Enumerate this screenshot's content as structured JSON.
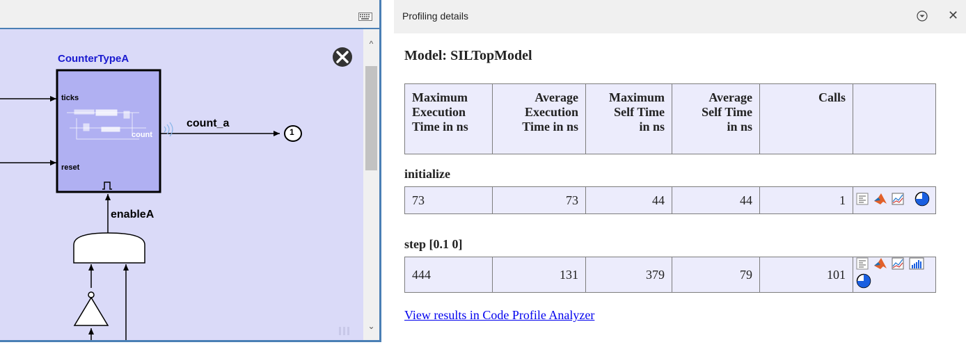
{
  "canvas": {
    "block_title": "CounterTypeA",
    "ports_in": [
      "ticks",
      "reset"
    ],
    "port_out": "count",
    "signal_out": "count_a",
    "outport_number": "1",
    "enable_label": "enableA"
  },
  "panel": {
    "title": "Profiling details",
    "model_title": "Model: SILTopModel",
    "headers": [
      "Maximum\nExecution\nTime in ns",
      "Average\nExecution\nTime in ns",
      "Maximum\nSelf Time\nin ns",
      "Average\nSelf Time\nin ns",
      "Calls"
    ],
    "sections": [
      {
        "name": "initialize",
        "values": [
          "73",
          "73",
          "44",
          "44",
          "1"
        ],
        "icons": [
          "code-report-icon",
          "matlab-icon",
          "plot-icon",
          "pie-chart-icon"
        ]
      },
      {
        "name": "step [0.1 0]",
        "values": [
          "444",
          "131",
          "379",
          "79",
          "101"
        ],
        "icons": [
          "code-report-icon",
          "matlab-icon",
          "plot-icon",
          "histogram-icon",
          "pie-chart-icon"
        ]
      }
    ],
    "link_text": "View results in Code Profile Analyzer"
  },
  "colors": {
    "canvas_bg": "#dadaf8",
    "block_fill": "#b0b0f2",
    "block_title": "#1a1ad0",
    "border_accent": "#4a7fb5",
    "table_bg": "#ececfc",
    "link": "#0000ee"
  }
}
